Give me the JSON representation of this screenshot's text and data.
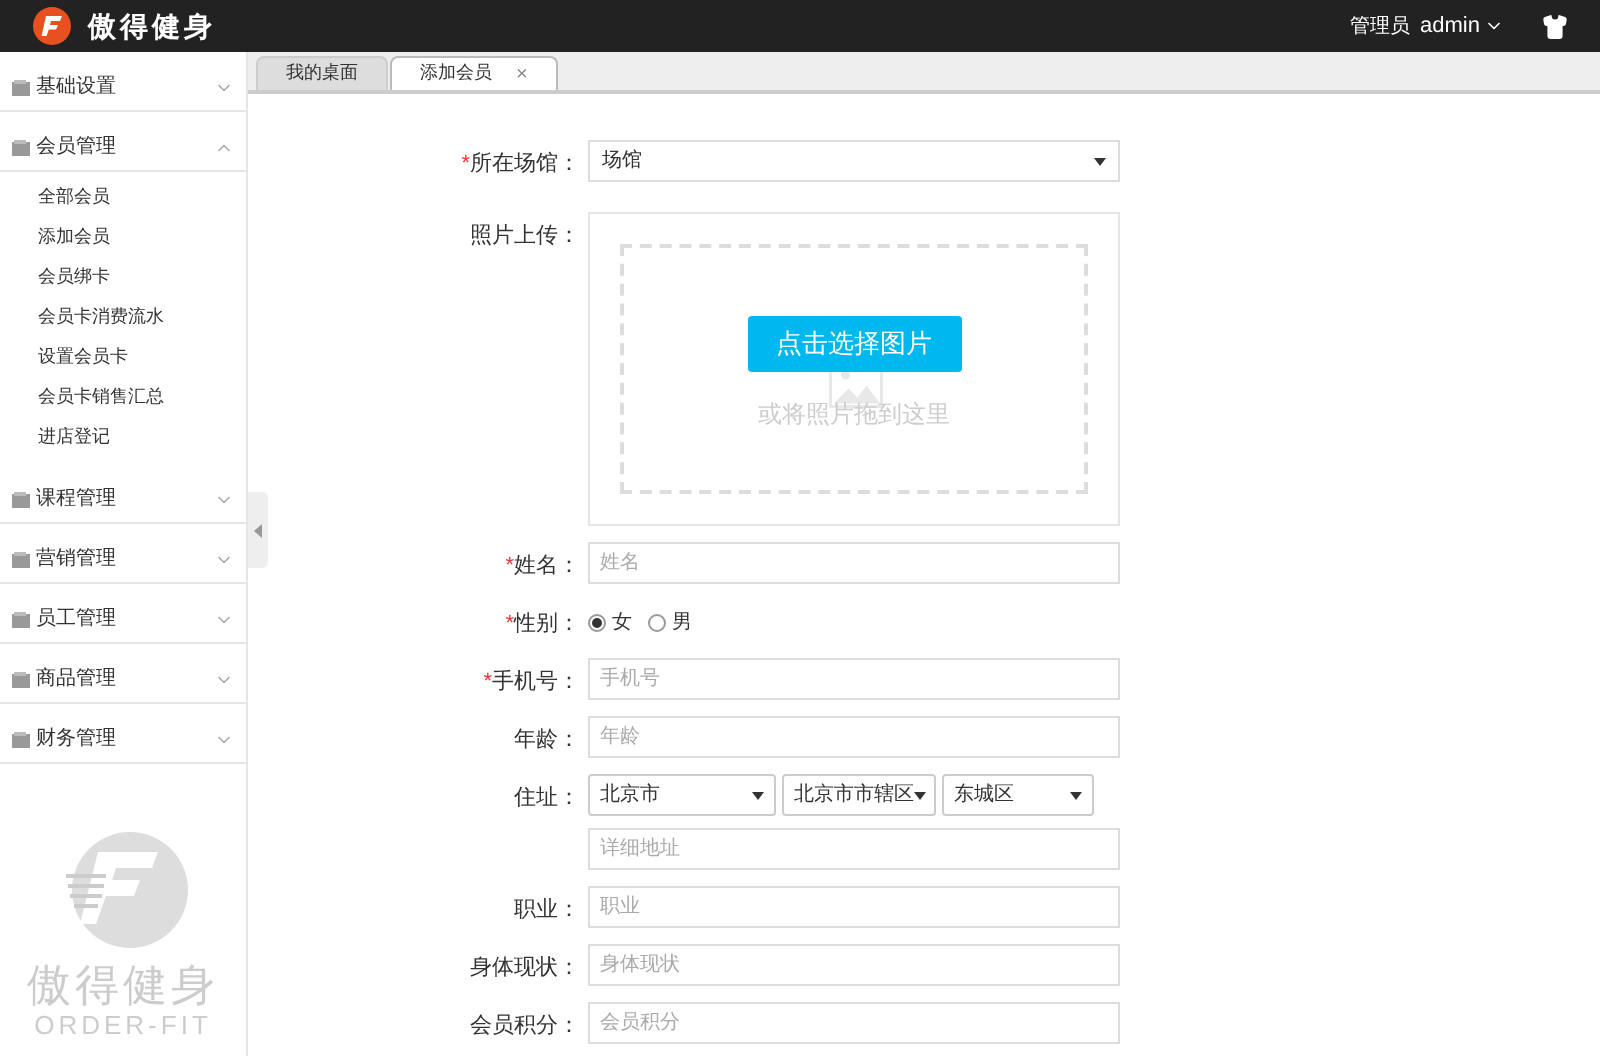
{
  "header": {
    "brand": "傲得健身",
    "user_role": "管理员",
    "user_name": "admin"
  },
  "sidebar": {
    "menus": [
      {
        "label": "基础设置",
        "expanded": false
      },
      {
        "label": "会员管理",
        "expanded": true,
        "children": [
          {
            "label": "全部会员",
            "selected": false
          },
          {
            "label": "添加会员",
            "selected": false
          },
          {
            "label": "会员绑卡",
            "selected": false
          },
          {
            "label": "会员卡消费流水",
            "selected": false
          },
          {
            "label": "设置会员卡",
            "selected": false
          },
          {
            "label": "会员卡销售汇总",
            "selected": false
          },
          {
            "label": "进店登记",
            "selected": false
          }
        ]
      },
      {
        "label": "课程管理",
        "expanded": false
      },
      {
        "label": "营销管理",
        "expanded": false
      },
      {
        "label": "员工管理",
        "expanded": false
      },
      {
        "label": "商品管理",
        "expanded": false
      },
      {
        "label": "财务管理",
        "expanded": false
      }
    ],
    "logo": {
      "title": "傲得健身",
      "subtitle": "ORDER-FIT"
    }
  },
  "tabs": [
    {
      "label": "我的桌面",
      "selected": false,
      "closable": false
    },
    {
      "label": "添加会员",
      "selected": true,
      "closable": true,
      "close": "×"
    }
  ],
  "form": {
    "fields": [
      {
        "kind": "select",
        "required_mark": "*",
        "label": "所在场馆：",
        "value": "场馆"
      },
      {
        "kind": "upload",
        "label": "照片上传：",
        "button": "点击选择图片",
        "hint": "或将照片拖到这里"
      },
      {
        "kind": "text",
        "required_mark": "*",
        "label": "姓名：",
        "placeholder": "姓名"
      },
      {
        "kind": "radio",
        "required_mark": "*",
        "label": "性别：",
        "options": [
          {
            "label": "女",
            "selected": true
          },
          {
            "label": "男",
            "selected": false
          }
        ]
      },
      {
        "kind": "text",
        "required_mark": "*",
        "label": "手机号：",
        "placeholder": "手机号"
      },
      {
        "kind": "text",
        "label": "年龄：",
        "placeholder": "年龄"
      },
      {
        "kind": "address",
        "label": "住址：",
        "selects": [
          "北京市",
          "北京市市辖区",
          "东城区"
        ],
        "placeholder": "详细地址"
      },
      {
        "kind": "text",
        "label": "职业：",
        "placeholder": "职业"
      },
      {
        "kind": "text",
        "label": "身体现状：",
        "placeholder": "身体现状"
      },
      {
        "kind": "text",
        "label": "会员积分：",
        "placeholder": "会员积分"
      }
    ]
  }
}
